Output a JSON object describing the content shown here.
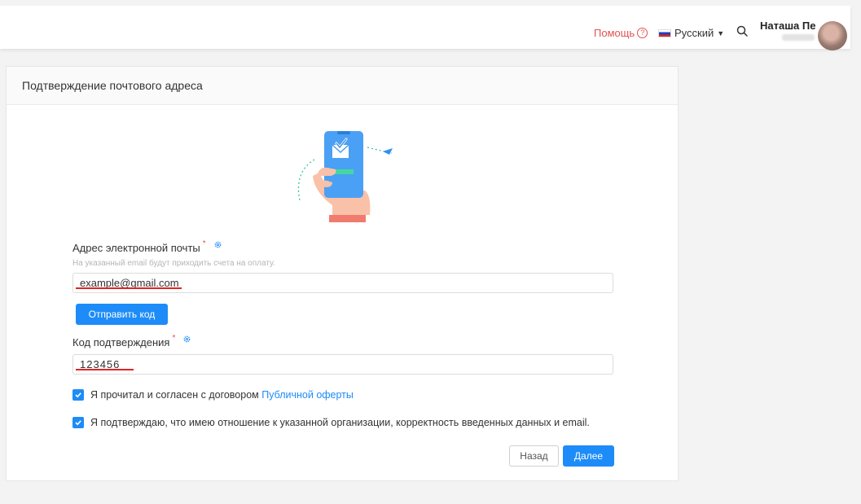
{
  "topbar": {
    "help_label": "Помощь",
    "language": "Русский",
    "user_name": "Наташа Пе"
  },
  "card": {
    "title": "Подтверждение почтового адреса",
    "email": {
      "label": "Адрес электронной почты",
      "required_mark": "*",
      "hint": "На указанный email будут приходить счета на оплату.",
      "value": "example@gmail.com"
    },
    "send_code_label": "Отправить код",
    "code": {
      "label": "Код подтверждения",
      "required_mark": "*",
      "value": "123456"
    },
    "agree_offer": {
      "text": "Я прочитал и согласен с договором",
      "link": "Публичной оферты",
      "checked": true
    },
    "agree_confirm": {
      "text": "Я подтверждаю, что имею отношение к указанной организации, корректность введенных данных и email.",
      "checked": true
    },
    "back_label": "Назад",
    "next_label": "Далее"
  },
  "colors": {
    "accent": "#1d8cf8",
    "danger": "#e05252",
    "annotation_underline": "#e02424"
  }
}
